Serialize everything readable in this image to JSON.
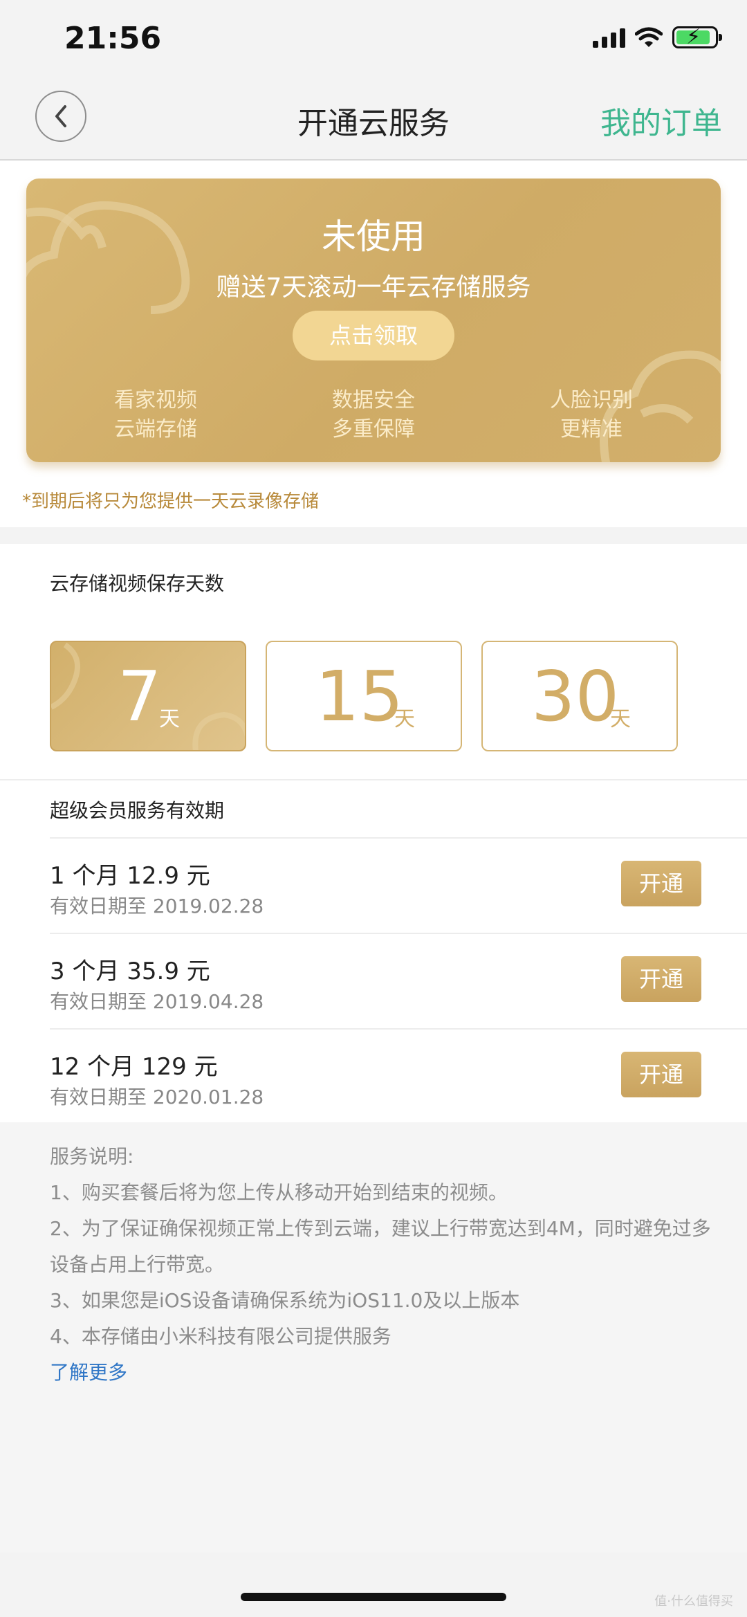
{
  "status_bar": {
    "time": "21:56"
  },
  "nav": {
    "title": "开通云服务",
    "my_orders": "我的订单"
  },
  "promo": {
    "status": "未使用",
    "description": "赠送7天滚动一年云存储服务",
    "claim_button": "点击领取",
    "features": [
      {
        "line1": "看家视频",
        "line2": "云端存储"
      },
      {
        "line1": "数据安全",
        "line2": "多重保障"
      },
      {
        "line1": "人脸识别",
        "line2": "更精准"
      }
    ],
    "expiry_note": "*到期后将只为您提供一天云录像存储"
  },
  "days": {
    "label": "云存储视频保存天数",
    "options": [
      {
        "number": "7",
        "unit": "天",
        "selected": true
      },
      {
        "number": "15",
        "unit": "天",
        "selected": false
      },
      {
        "number": "30",
        "unit": "天",
        "selected": false
      }
    ]
  },
  "member": {
    "label": "超级会员服务有效期",
    "plans": [
      {
        "title": "1 个月  12.9 元",
        "validity": "有效日期至 2019.02.28",
        "button": "开通"
      },
      {
        "title": "3 个月  35.9 元",
        "validity": "有效日期至 2019.04.28",
        "button": "开通"
      },
      {
        "title": "12 个月  129 元",
        "validity": "有效日期至 2020.01.28",
        "button": "开通"
      }
    ]
  },
  "notes": {
    "heading": "服务说明:",
    "items": [
      "1、购买套餐后将为您上传从移动开始到结束的视频。",
      "2、为了保证确保视频正常上传到云端，建议上行带宽达到4M，同时避免过多设备占用上行带宽。",
      "3、如果您是iOS设备请确保系统为iOS11.0及以上版本",
      "4、本存储由小米科技有限公司提供服务"
    ],
    "learn_more": "了解更多"
  },
  "watermark": "值·什么值得买",
  "colors": {
    "gold": "#d2ad67",
    "green_link": "#3fb68f",
    "blue_link": "#2f76c6"
  }
}
